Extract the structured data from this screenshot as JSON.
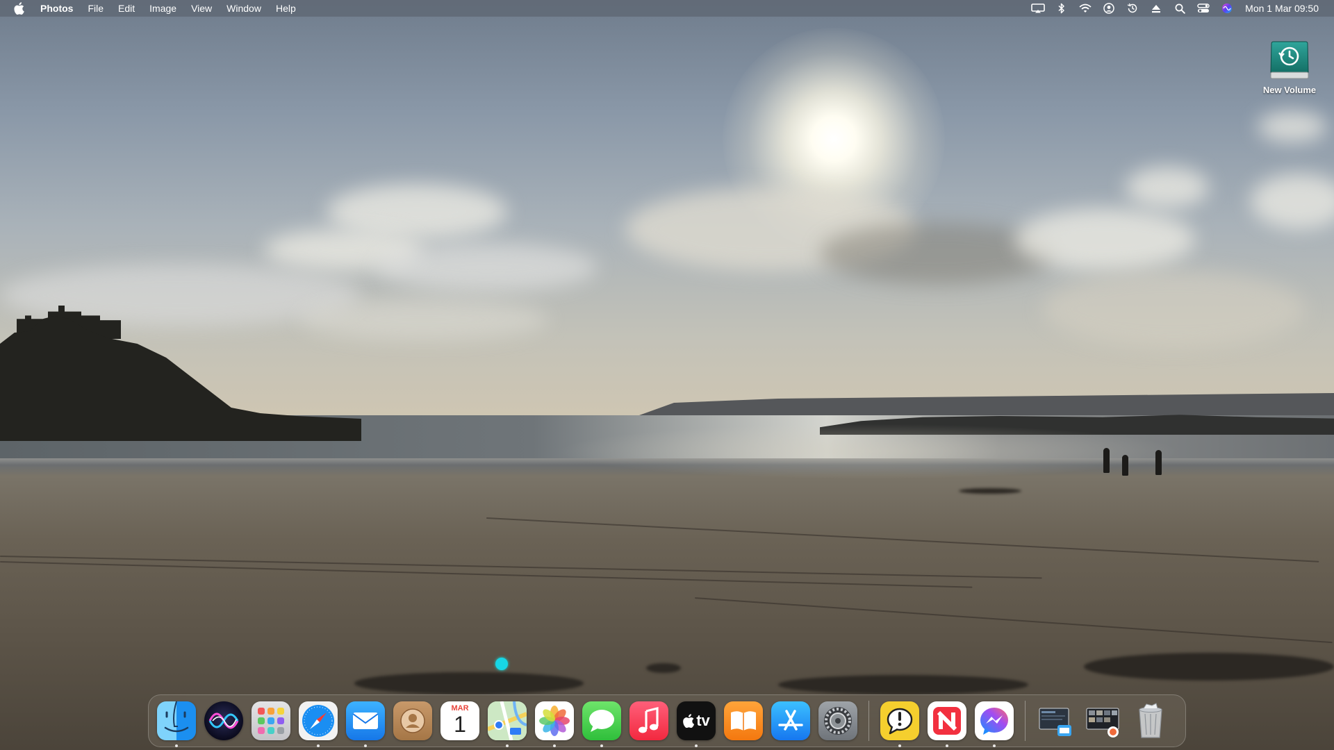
{
  "menubar": {
    "app_name": "Photos",
    "menus": [
      "File",
      "Edit",
      "Image",
      "View",
      "Window",
      "Help"
    ],
    "status_icons": [
      "screen-mirroring-icon",
      "bluetooth-icon",
      "wifi-icon",
      "user-icon",
      "time-machine-icon",
      "eject-icon",
      "spotlight-search-icon",
      "control-center-icon",
      "siri-icon"
    ],
    "clock": "Mon 1 Mar  09:50"
  },
  "desktop": {
    "icons": [
      {
        "label": "New Volume",
        "icon": "time-machine-drive-icon"
      }
    ]
  },
  "dock": {
    "apps": [
      {
        "name": "Finder",
        "icon": "finder-icon",
        "running": true
      },
      {
        "name": "Siri",
        "icon": "siri-icon",
        "running": false
      },
      {
        "name": "Launchpad",
        "icon": "launchpad-icon",
        "running": false
      },
      {
        "name": "Safari",
        "icon": "safari-icon",
        "running": true
      },
      {
        "name": "Mail",
        "icon": "mail-icon",
        "running": true
      },
      {
        "name": "Contacts",
        "icon": "contacts-icon",
        "running": false
      },
      {
        "name": "Calendar",
        "icon": "calendar-icon",
        "running": false,
        "month": "MAR",
        "day": "1"
      },
      {
        "name": "Maps",
        "icon": "maps-icon",
        "running": true
      },
      {
        "name": "Photos",
        "icon": "photos-icon",
        "running": true
      },
      {
        "name": "Messages",
        "icon": "messages-icon",
        "running": true
      },
      {
        "name": "Music",
        "icon": "music-icon",
        "running": false
      },
      {
        "name": "TV",
        "icon": "apple-tv-icon",
        "running": true,
        "label": "tv"
      },
      {
        "name": "Books",
        "icon": "books-icon",
        "running": false
      },
      {
        "name": "App Store",
        "icon": "app-store-icon",
        "running": false
      },
      {
        "name": "System Preferences",
        "icon": "system-preferences-icon",
        "running": false
      }
    ],
    "apps_secondary": [
      {
        "name": "Feedback Assistant",
        "icon": "feedback-assistant-icon",
        "running": true
      },
      {
        "name": "News",
        "icon": "news-icon",
        "running": true
      },
      {
        "name": "Messenger",
        "icon": "messenger-icon",
        "running": true
      }
    ],
    "stacks": [
      {
        "name": "Documents stack",
        "icon": "documents-stack-icon"
      },
      {
        "name": "Downloads stack",
        "icon": "downloads-stack-icon"
      },
      {
        "name": "Trash",
        "icon": "trash-icon"
      }
    ]
  },
  "colors": {
    "menubar": "#5f6874",
    "cursor": "#17d6e6",
    "calendar_red": "#e8453c"
  }
}
